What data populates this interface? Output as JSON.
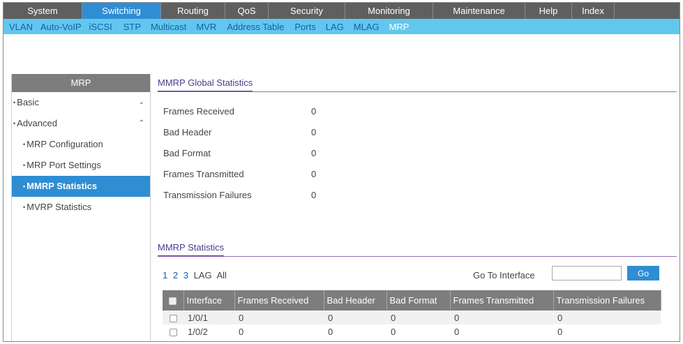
{
  "top_nav": [
    {
      "label": "System",
      "width": 113,
      "active": false
    },
    {
      "label": "Switching",
      "width": 113,
      "active": true
    },
    {
      "label": "Routing",
      "width": 92,
      "active": false
    },
    {
      "label": "QoS",
      "width": 62,
      "active": false
    },
    {
      "label": "Security",
      "width": 110,
      "active": false
    },
    {
      "label": "Monitoring",
      "width": 126,
      "active": false
    },
    {
      "label": "Maintenance",
      "width": 132,
      "active": false
    },
    {
      "label": "Help",
      "width": 67,
      "active": false
    },
    {
      "label": "Index",
      "width": 61,
      "active": false
    }
  ],
  "sub_nav": [
    "VLAN",
    "Auto-VoIP",
    "iSCSI",
    "STP",
    "Multicast",
    "MVR",
    "Address Table",
    "Ports",
    "LAG",
    "MLAG",
    "MRP"
  ],
  "sub_nav_active": "MRP",
  "sidebar": {
    "title": "MRP",
    "items": [
      {
        "label": "Basic",
        "chevron": "⌄"
      },
      {
        "label": "Advanced",
        "chevron": "⌃"
      },
      {
        "label": "MRP Configuration"
      },
      {
        "label": "MRP Port Settings"
      },
      {
        "label": "MMRP Statistics"
      },
      {
        "label": "MVRP Statistics"
      }
    ]
  },
  "global_stats": {
    "title": "MMRP Global Statistics",
    "rows": [
      {
        "label": "Frames Received",
        "value": "0"
      },
      {
        "label": "Bad Header",
        "value": "0"
      },
      {
        "label": "Bad Format",
        "value": "0"
      },
      {
        "label": "Frames Transmitted",
        "value": "0"
      },
      {
        "label": "Transmission Failures",
        "value": "0"
      }
    ]
  },
  "mmrp_stats": {
    "title": "MMRP Statistics",
    "pager": [
      "1",
      "2",
      "3",
      "LAG",
      "All"
    ],
    "goto_label": "Go To Interface",
    "goto_value": "",
    "go_label": "Go",
    "columns": [
      "Interface",
      "Frames Received",
      "Bad Header",
      "Bad Format",
      "Frames Transmitted",
      "Transmission Failures"
    ],
    "rows": [
      [
        "1/0/1",
        "0",
        "0",
        "0",
        "0",
        "0"
      ],
      [
        "1/0/2",
        "0",
        "0",
        "0",
        "0",
        "0"
      ]
    ]
  },
  "colors": {
    "top_active": "#2f8dd4",
    "sub_nav_bg": "#62c7ee",
    "section_accent": "#5a3d94"
  }
}
